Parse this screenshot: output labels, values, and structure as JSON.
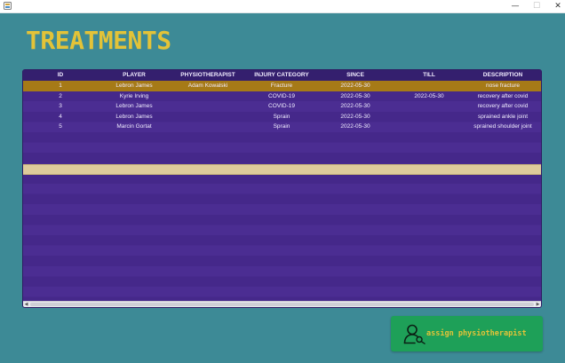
{
  "page": {
    "title": "TREATMENTS"
  },
  "window": {
    "minimize": "—",
    "maximize": "☐",
    "close": "✕"
  },
  "table": {
    "columns": [
      "ID",
      "PLAYER",
      "PHYSIOTHERAPIST",
      "INJURY CATEGORY",
      "SINCE",
      "TILL",
      "DESCRIPTION"
    ],
    "rows": [
      {
        "id": "1",
        "player": "Lebron James",
        "physiotherapist": "Adam Kowalski",
        "injury_category": "Fracture",
        "since": "2022-05-30",
        "till": "",
        "description": "nose fracture"
      },
      {
        "id": "2",
        "player": "Kyrie Irving",
        "physiotherapist": "",
        "injury_category": "COVID-19",
        "since": "2022-05-30",
        "till": "2022-05-30",
        "description": "recovery after covid"
      },
      {
        "id": "3",
        "player": "Lebron James",
        "physiotherapist": "",
        "injury_category": "COVID-19",
        "since": "2022-05-30",
        "till": "",
        "description": "recovery after covid"
      },
      {
        "id": "4",
        "player": "Lebron James",
        "physiotherapist": "",
        "injury_category": "Sprain",
        "since": "2022-05-30",
        "till": "",
        "description": "sprained ankle joint"
      },
      {
        "id": "5",
        "player": "Marcin Gortat",
        "physiotherapist": "",
        "injury_category": "Sprain",
        "since": "2022-05-30",
        "till": "",
        "description": "sprained shoulder joint"
      }
    ],
    "selected_row_index": 0
  },
  "actions": {
    "assign_label": "assign physiotherapist"
  },
  "colors": {
    "background": "#3d8a96",
    "title": "#e3c338",
    "table_background": "#462a8d",
    "header_background": "#341f6e",
    "selected_row": "#a67a17",
    "highlight_row": "#decb9b",
    "button": "#1ea058"
  },
  "icons": {
    "app": "app-icon",
    "assign": "user-icon"
  }
}
